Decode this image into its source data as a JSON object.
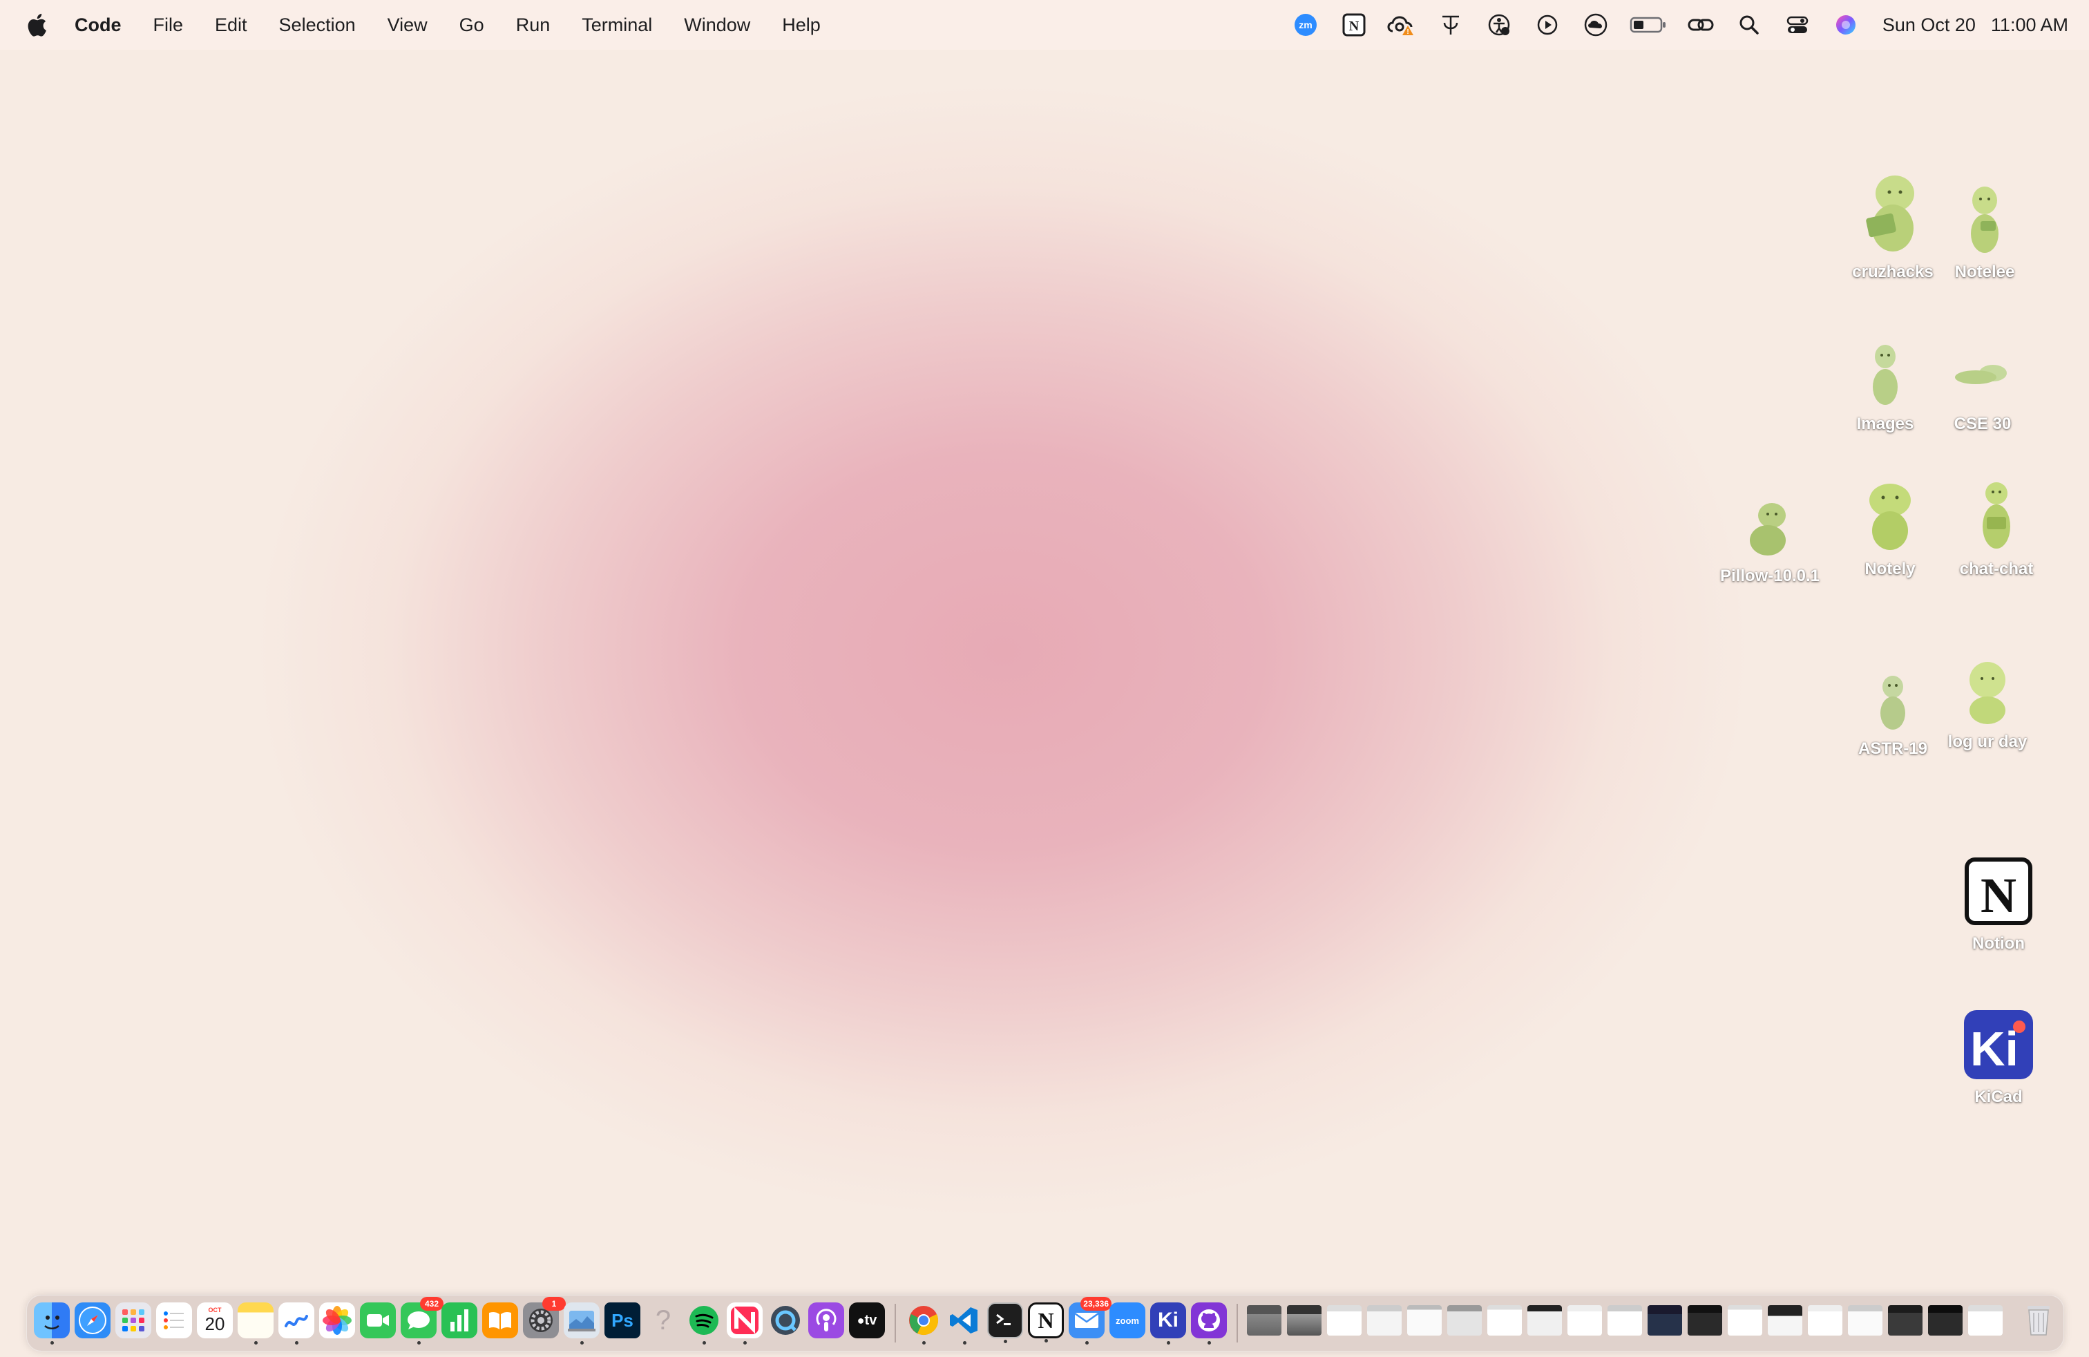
{
  "menubar": {
    "app_name": "Code",
    "menus": [
      "File",
      "Edit",
      "Selection",
      "View",
      "Go",
      "Run",
      "Terminal",
      "Window",
      "Help"
    ],
    "status_icons": [
      "zoom-icon",
      "notion-icon",
      "creative-cloud-icon",
      "text-tool-icon",
      "accessibility-icon",
      "play-icon",
      "cloud-icon",
      "battery-icon",
      "link-icon",
      "search-icon",
      "control-center-icon",
      "siri-icon"
    ],
    "date": "Sun Oct 20",
    "time": "11:00 AM"
  },
  "desktop_icons": [
    {
      "label": "cruzhacks"
    },
    {
      "label": "Notelee"
    },
    {
      "label": "Images"
    },
    {
      "label": "CSE 30"
    },
    {
      "label": "Pillow-10.0.1"
    },
    {
      "label": "Notely"
    },
    {
      "label": "chat-chat"
    },
    {
      "label": "ASTR-19"
    },
    {
      "label": "log ur day"
    },
    {
      "label": "Notion"
    },
    {
      "label": "KiCad"
    }
  ],
  "dock": {
    "apps": [
      "Finder",
      "Safari",
      "Launchpad",
      "Reminders",
      "Calendar",
      "Notes",
      "Freeform",
      "Photos",
      "FaceTime",
      "Messages",
      "Numbers",
      "Books",
      "System Settings",
      "Preview",
      "Photoshop",
      "Help",
      "Spotify",
      "News",
      "QuickTime",
      "Podcasts",
      "Apple TV",
      "Chrome",
      "VS Code",
      "Terminal",
      "Notion",
      "Mail",
      "Zoom",
      "KiCad",
      "GitHub Desktop"
    ],
    "calendar_month": "OCT",
    "calendar_day": "20",
    "messages_badge": "432",
    "settings_badge": "1",
    "mail_badge": "23,336",
    "zoom_label": "zoom",
    "kicad_label": "Ki",
    "photoshop_label": "Ps",
    "notion_label": "N",
    "appletv_label": "tv"
  }
}
